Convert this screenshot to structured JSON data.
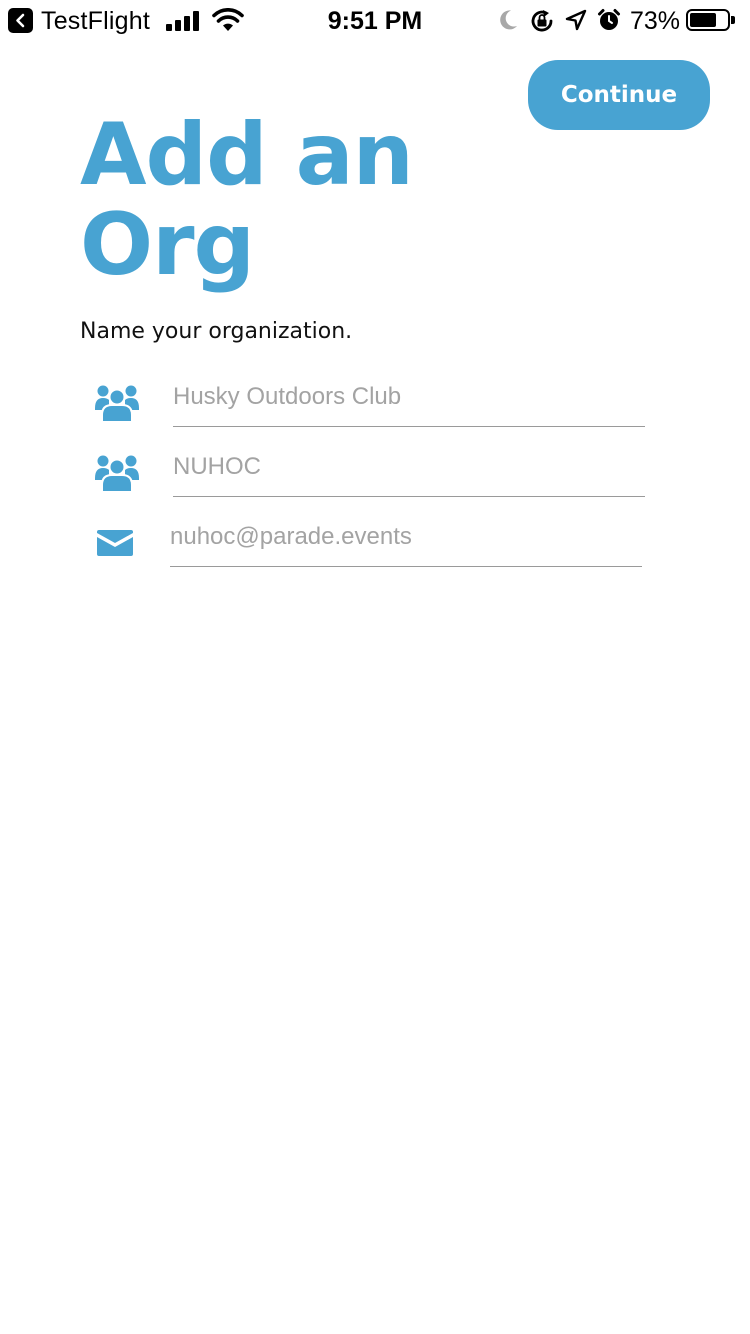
{
  "status_bar": {
    "back_app": "TestFlight",
    "time": "9:51 PM",
    "battery_percent": "73%",
    "battery_level": 0.73,
    "signal_bars": 4,
    "icons": [
      "back-arrow-icon",
      "signal-icon",
      "wifi-icon",
      "moon-icon",
      "rotation-lock-icon",
      "location-arrow-icon",
      "alarm-clock-icon",
      "battery-icon"
    ]
  },
  "header": {
    "continue_label": "Continue"
  },
  "main": {
    "title": "Add an Org",
    "subtitle": "Name your organization."
  },
  "form": {
    "fields": [
      {
        "icon": "users-group-icon",
        "placeholder": "Husky Outdoors Club",
        "value": ""
      },
      {
        "icon": "users-group-icon",
        "placeholder": "NUHOC",
        "value": ""
      },
      {
        "icon": "envelope-icon",
        "placeholder": "nuhoc@parade.events",
        "value": ""
      }
    ]
  },
  "colors": {
    "accent": "#48a3d2",
    "text": "#111111",
    "placeholder": "#a3a3a3",
    "divider": "#9a9a9a",
    "background": "#ffffff"
  }
}
